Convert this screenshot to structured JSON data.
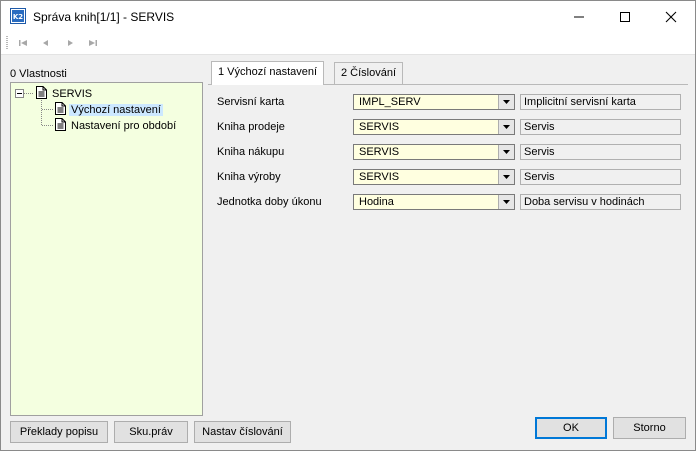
{
  "window": {
    "title": "Správa knih[1/1] - SERVIS",
    "app_icon": "k2-app-icon",
    "controls": [
      "minimize-icon",
      "maximize-icon",
      "close-icon"
    ]
  },
  "toolbar": {
    "buttons": [
      "first-record-icon",
      "previous-record-icon",
      "next-record-icon",
      "last-record-icon"
    ]
  },
  "left_panel": {
    "label": "0 Vlastnosti",
    "tree": {
      "root": "SERVIS",
      "children": [
        "Výchozí nastavení",
        "Nastavení pro období"
      ],
      "selected": "Výchozí nastavení"
    }
  },
  "tabs": [
    {
      "label": "1 Výchozí nastavení",
      "active": true
    },
    {
      "label": "2 Číslování",
      "active": false
    }
  ],
  "form": {
    "rows": [
      {
        "label": "Servisní karta",
        "value": "IMPL_SERV",
        "description": "Implicitní servisní karta"
      },
      {
        "label": "Kniha prodeje",
        "value": "SERVIS",
        "description": "Servis"
      },
      {
        "label": "Kniha nákupu",
        "value": "SERVIS",
        "description": "Servis"
      },
      {
        "label": "Kniha výroby",
        "value": "SERVIS",
        "description": "Servis"
      },
      {
        "label": "Jednotka doby úkonu",
        "value": "Hodina",
        "description": "Doba servisu v hodinách"
      }
    ]
  },
  "bottom_buttons": {
    "preklady": "Překlady popisu",
    "sku_prav": "Sku.práv",
    "nastav_cislovani": "Nastav číslování",
    "ok": "OK",
    "storno": "Storno"
  },
  "colors": {
    "tree_background": "#f4ffe0",
    "combo_background": "#ffffe0",
    "selection": "#cce8ff",
    "default_button_border": "#0078d7"
  }
}
